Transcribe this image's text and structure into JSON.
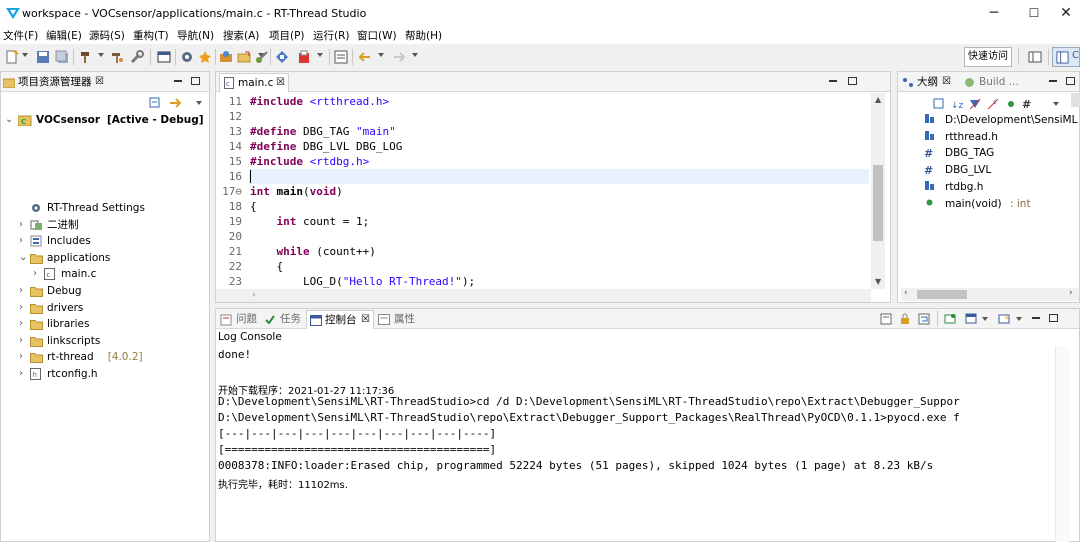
{
  "window": {
    "title": "workspace - VOCsensor/applications/main.c - RT-Thread Studio",
    "min_glyph": "─",
    "max_glyph": "☐",
    "close_glyph": "✕"
  },
  "menu": [
    "文件(F)",
    "编辑(E)",
    "源码(S)",
    "重构(T)",
    "导航(N)",
    "搜索(A)",
    "项目(P)",
    "运行(R)",
    "窗口(W)",
    "帮助(H)"
  ],
  "toolbar": {
    "quick_access": "快速访问",
    "icons": [
      "new-icon",
      "save-icon",
      "save-all-icon",
      "print-icon",
      "build-icon",
      "debug-icon",
      "download-icon",
      "terminal-icon",
      "settings-icon",
      "sdk-icon",
      "open-icon",
      "flash-icon",
      "console-icon",
      "search-icon",
      "run-icon",
      "back-icon",
      "forward-icon",
      "perspective-icon",
      "cpp-perspective-icon"
    ]
  },
  "project_explorer": {
    "tab_label": "项目资源管理器",
    "close": "☒",
    "project": {
      "name": "VOCsensor",
      "state": "[Active - Debug]"
    },
    "items": [
      {
        "label": "RT-Thread Settings",
        "chevron": "",
        "icon": "settings-icon",
        "indent": 1
      },
      {
        "label": "二进制",
        "chevron": "›",
        "icon": "binary-icon",
        "indent": 1
      },
      {
        "label": "Includes",
        "chevron": "›",
        "icon": "includes-icon",
        "indent": 1
      },
      {
        "label": "applications",
        "chevron": "⌄",
        "icon": "folder-icon",
        "indent": 1
      },
      {
        "label": "main.c",
        "chevron": "›",
        "icon": "c-file-icon",
        "indent": 2
      },
      {
        "label": "Debug",
        "chevron": "›",
        "icon": "folder-icon",
        "indent": 1
      },
      {
        "label": "drivers",
        "chevron": "›",
        "icon": "folder-icon",
        "indent": 1
      },
      {
        "label": "libraries",
        "chevron": "›",
        "icon": "folder-icon",
        "indent": 1
      },
      {
        "label": "linkscripts",
        "chevron": "›",
        "icon": "folder-icon",
        "indent": 1
      },
      {
        "label": "rt-thread",
        "decoration": "[4.0.2]",
        "chevron": "›",
        "icon": "folder-icon",
        "indent": 1
      },
      {
        "label": "rtconfig.h",
        "chevron": "›",
        "icon": "h-file-icon",
        "indent": 1
      }
    ]
  },
  "editor": {
    "tab_label": "main.c",
    "close": "☒",
    "lines": [
      {
        "n": "11",
        "parts": [
          {
            "t": "#include",
            "c": "kw"
          },
          {
            "t": " ",
            "c": ""
          },
          {
            "t": "<rtthread.h>",
            "c": "str"
          }
        ]
      },
      {
        "n": "12",
        "parts": []
      },
      {
        "n": "13",
        "parts": [
          {
            "t": "#define",
            "c": "kw"
          },
          {
            "t": " DBG_TAG ",
            "c": ""
          },
          {
            "t": "\"main\"",
            "c": "str"
          }
        ]
      },
      {
        "n": "14",
        "parts": [
          {
            "t": "#define",
            "c": "kw"
          },
          {
            "t": " DBG_LVL DBG_LOG",
            "c": ""
          }
        ]
      },
      {
        "n": "15",
        "parts": [
          {
            "t": "#include",
            "c": "kw"
          },
          {
            "t": " ",
            "c": ""
          },
          {
            "t": "<rtdbg.h>",
            "c": "str"
          }
        ]
      },
      {
        "n": "16",
        "parts": []
      },
      {
        "n": "17⊖",
        "parts": [
          {
            "t": "int",
            "c": "kw"
          },
          {
            "t": " ",
            "c": ""
          },
          {
            "t": "main",
            "c": "b"
          },
          {
            "t": "(",
            "c": ""
          },
          {
            "t": "void",
            "c": "kw"
          },
          {
            "t": ")",
            "c": ""
          }
        ]
      },
      {
        "n": "18",
        "parts": [
          {
            "t": "{",
            "c": ""
          }
        ]
      },
      {
        "n": "19",
        "parts": [
          {
            "t": "    ",
            "c": ""
          },
          {
            "t": "int",
            "c": "kw"
          },
          {
            "t": " count = 1;",
            "c": ""
          }
        ]
      },
      {
        "n": "20",
        "parts": []
      },
      {
        "n": "21",
        "parts": [
          {
            "t": "    ",
            "c": ""
          },
          {
            "t": "while",
            "c": "kw"
          },
          {
            "t": " (count++)",
            "c": ""
          }
        ]
      },
      {
        "n": "22",
        "parts": [
          {
            "t": "    {",
            "c": ""
          }
        ]
      },
      {
        "n": "23",
        "parts": [
          {
            "t": "        LOG_D(",
            "c": ""
          },
          {
            "t": "\"Hello RT-Thread!\"",
            "c": "str"
          },
          {
            "t": ");",
            "c": ""
          }
        ]
      }
    ]
  },
  "outline": {
    "tabs": [
      {
        "label": "大纲",
        "close": "☒"
      },
      {
        "label": "Build ..."
      }
    ],
    "items": [
      {
        "label": "D:\\Development\\SensiML",
        "icon": "include-icon",
        "suffix": ""
      },
      {
        "label": "rtthread.h",
        "icon": "include-icon",
        "suffix": ""
      },
      {
        "label": "DBG_TAG",
        "icon": "macro-icon",
        "suffix": ""
      },
      {
        "label": "DBG_LVL",
        "icon": "macro-icon",
        "suffix": ""
      },
      {
        "label": "rtdbg.h",
        "icon": "include-icon",
        "suffix": ""
      },
      {
        "label": "main(void)",
        "icon": "function-icon",
        "suffix": " : int"
      }
    ]
  },
  "console": {
    "tabs": [
      {
        "label": "问题"
      },
      {
        "label": "任务"
      },
      {
        "label": "控制台",
        "close": "☒"
      },
      {
        "label": "属性"
      }
    ],
    "title": "Log Console",
    "lines": [
      {
        "text": "done!",
        "cn": false
      },
      {
        "text": "",
        "cn": false
      },
      {
        "text": "开始下载程序：2021-01-27 11:17:36",
        "cn": true
      },
      {
        "text": "D:\\Development\\SensiML\\RT-ThreadStudio>cd /d D:\\Development\\SensiML\\RT-ThreadStudio\\repo\\Extract\\Debugger_Suppor",
        "cn": false
      },
      {
        "text": "D:\\Development\\SensiML\\RT-ThreadStudio\\repo\\Extract\\Debugger_Support_Packages\\RealThread\\PyOCD\\0.1.1>pyocd.exe f",
        "cn": false
      },
      {
        "text": "[---|---|---|---|---|---|---|---|---|----]",
        "cn": false
      },
      {
        "text": "[========================================]",
        "cn": false
      },
      {
        "text": "0008378:INFO:loader:Erased chip, programmed 52224 bytes (51 pages), skipped 1024 bytes (1 page) at 8.23 kB/s",
        "cn": false
      },
      {
        "text": "执行完毕，耗时：11102ms.",
        "cn": true
      }
    ]
  }
}
